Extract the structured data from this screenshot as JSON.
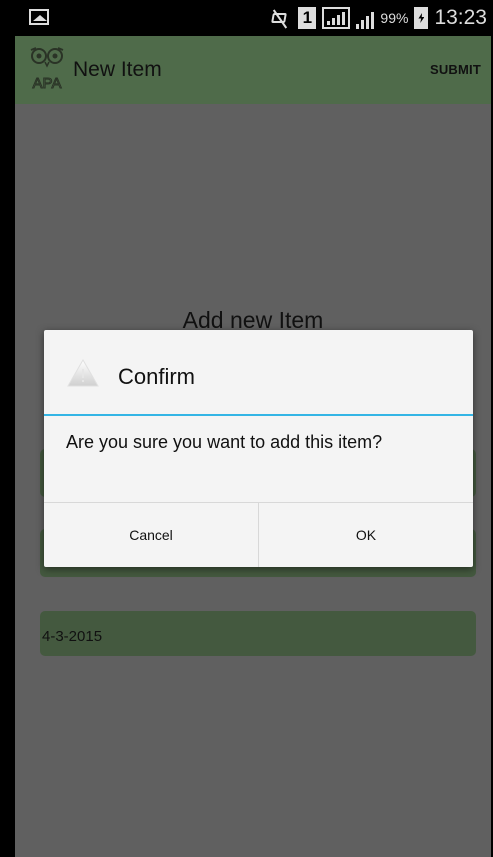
{
  "status_bar": {
    "battery_percent": "99%",
    "time": "13:23",
    "sim_slot": "1"
  },
  "action_bar": {
    "title": "New Item",
    "submit_label": "SUBMIT",
    "logo_text": "APA"
  },
  "form": {
    "heading": "Add new Item",
    "date_value": "4-3-2015"
  },
  "dialog": {
    "title": "Confirm",
    "message": "Are you sure you want to add this item?",
    "cancel_label": "Cancel",
    "ok_label": "OK"
  },
  "colors": {
    "action_bar": "#4f6b4a",
    "field": "#44593f",
    "dim_overlay": "#606060",
    "dialog_accent": "#33b5e5"
  }
}
